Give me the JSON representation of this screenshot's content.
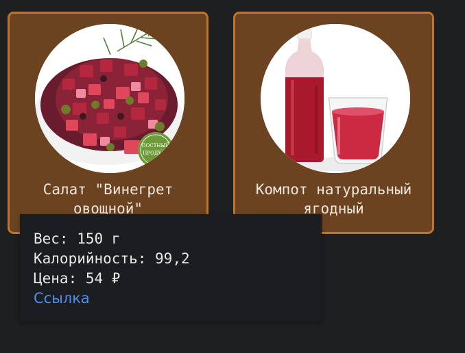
{
  "cards": [
    {
      "title": "Салат \"Винегрет\nовощной\"",
      "image": "vinaigrette-salad-photo",
      "badge_text": "ПОСТНЫЙ\nПРОДУКТ"
    },
    {
      "title": "Компот натуральный\nягодный",
      "image": "berry-compote-photo"
    }
  ],
  "tooltip": {
    "weight_label": "Вес:",
    "weight_value": "150 г",
    "calories_label": "Калорийность:",
    "calories_value": "99,2",
    "price_label": "Цена:",
    "price_value": "54 ₽",
    "link_text": "Ссылка"
  },
  "colors": {
    "page_background": "#1e1f21",
    "card_background": "#6b4320",
    "card_border": "#c0742c",
    "tooltip_background": "#1b1d20",
    "link": "#4f8fe8"
  }
}
